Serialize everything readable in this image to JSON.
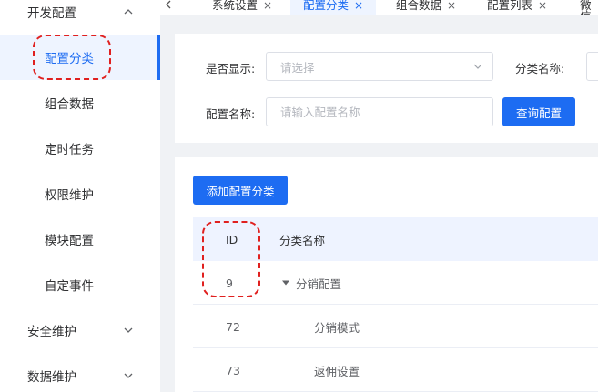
{
  "sidebar": {
    "groups": [
      {
        "label": "开发配置",
        "icon": "chevron-up-icon"
      },
      {
        "label": "安全维护",
        "icon": "chevron-down-icon"
      },
      {
        "label": "数据维护",
        "icon": "chevron-down-icon"
      }
    ],
    "items": [
      {
        "label": "配置分类",
        "active": true
      },
      {
        "label": "组合数据"
      },
      {
        "label": "定时任务"
      },
      {
        "label": "权限维护"
      },
      {
        "label": "模块配置"
      },
      {
        "label": "自定事件"
      }
    ]
  },
  "tabs": {
    "prev_icon": "chevron-left-icon",
    "items": [
      {
        "label": "系统设置",
        "close": "×"
      },
      {
        "label": "配置分类",
        "close": "×",
        "active": true
      },
      {
        "label": "组合数据",
        "close": "×"
      },
      {
        "label": "配置列表",
        "close": "×"
      },
      {
        "label": "微信"
      }
    ]
  },
  "filter": {
    "show_label": "是否显示:",
    "show_placeholder": "请选择",
    "category_label": "分类名称:",
    "config_label": "配置名称:",
    "config_placeholder": "请输入配置名称",
    "query_button": "查询配置"
  },
  "table": {
    "add_button": "添加配置分类",
    "headers": {
      "id": "ID",
      "name": "分类名称"
    },
    "rows": [
      {
        "id": "9",
        "name": "分销配置",
        "expandable": true
      },
      {
        "id": "72",
        "name": "分销模式"
      },
      {
        "id": "73",
        "name": "返佣设置"
      }
    ]
  },
  "colors": {
    "primary": "#1d6cf2",
    "highlight": "#e0201f",
    "header_bg": "#eef3ff"
  }
}
